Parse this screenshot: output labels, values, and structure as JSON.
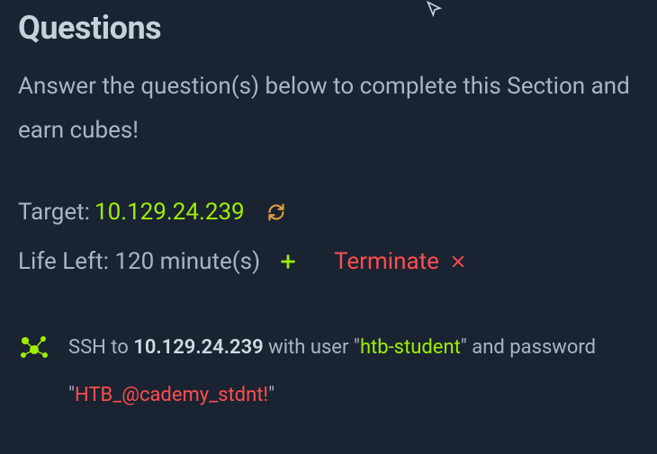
{
  "heading": "Questions",
  "subtext": "Answer the question(s) below to complete this Section and earn cubes!",
  "target": {
    "label": "Target: ",
    "ip": "10.129.24.239"
  },
  "life": {
    "text": "Life Left: 120 minute(s)"
  },
  "terminate": {
    "label": "Terminate"
  },
  "ssh": {
    "prefix": "SSH to ",
    "ip": "10.129.24.239",
    "mid1": " with user \"",
    "user": "htb-student",
    "mid2": "\" and password \"",
    "pass": "HTB_@cademy_stdnt!",
    "suffix": "\""
  },
  "colors": {
    "bg": "#1a2332",
    "text": "#a8b5c4",
    "accent_green": "#9fef00",
    "accent_red": "#ff4d4d",
    "accent_orange": "#e6a23c"
  }
}
